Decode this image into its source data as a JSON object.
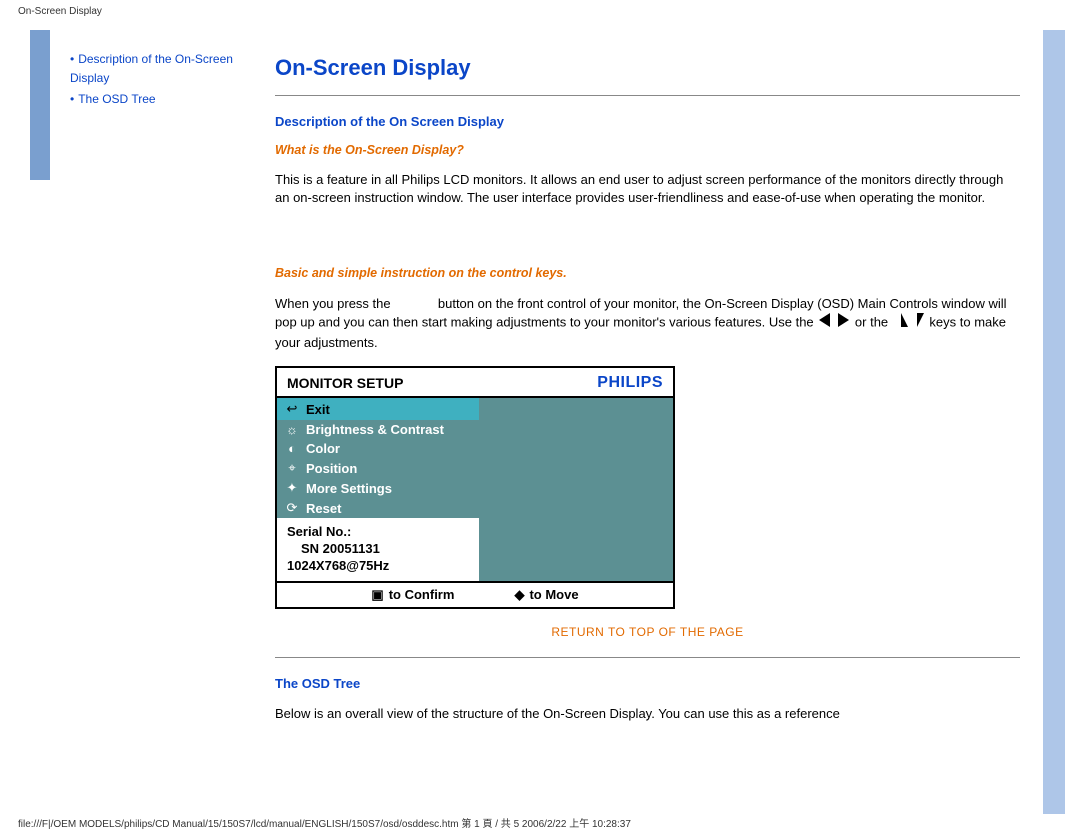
{
  "breadcrumb": "On-Screen Display",
  "sidebar": {
    "items": [
      {
        "label": "Description of the On-Screen Display"
      },
      {
        "label": "The OSD Tree"
      }
    ]
  },
  "main": {
    "title": "On-Screen Display",
    "section1_heading": "Description of the On Screen Display",
    "q1": "What is the On-Screen Display?",
    "p1": "This is a feature in all Philips LCD monitors. It allows an end user to adjust screen performance of the monitors directly through an on-screen instruction window. The user interface provides user-friendliness and ease-of-use when operating the monitor.",
    "q2": "Basic and simple instruction on the control keys.",
    "p2a": "When you press the",
    "p2b": "button on the front control of your monitor, the On-Screen Display (OSD) Main Controls window will pop up and you can then start making adjustments to your monitor's various features. Use the",
    "p2c": "or the",
    "p2d": "keys to make your adjustments.",
    "return": "RETURN TO TOP OF THE PAGE",
    "section2_heading": "The OSD Tree",
    "p3": "Below is an overall view of the structure of the On-Screen Display. You can use this as a reference"
  },
  "osd": {
    "header_title": "MONITOR SETUP",
    "brand": "PHILIPS",
    "items": [
      {
        "icon": "↩",
        "label": "Exit"
      },
      {
        "icon": "☼",
        "label": "Brightness & Contrast"
      },
      {
        "icon": "◐",
        "label": "Color"
      },
      {
        "icon": "⌖",
        "label": "Position"
      },
      {
        "icon": "✦",
        "label": "More Settings"
      },
      {
        "icon": "⟳",
        "label": "Reset"
      }
    ],
    "serial_label": "Serial No.:",
    "serial_value": "SN 20051131",
    "resolution": "1024X768@75Hz",
    "footer_confirm_icon": "▣",
    "footer_confirm": "to Confirm",
    "footer_move_icon": "◆",
    "footer_move": "to Move"
  },
  "footer_path": "file:///F|/OEM MODELS/philips/CD Manual/15/150S7/lcd/manual/ENGLISH/150S7/osd/osddesc.htm 第 1 頁 / 共 5 2006/2/22 上午 10:28:37"
}
